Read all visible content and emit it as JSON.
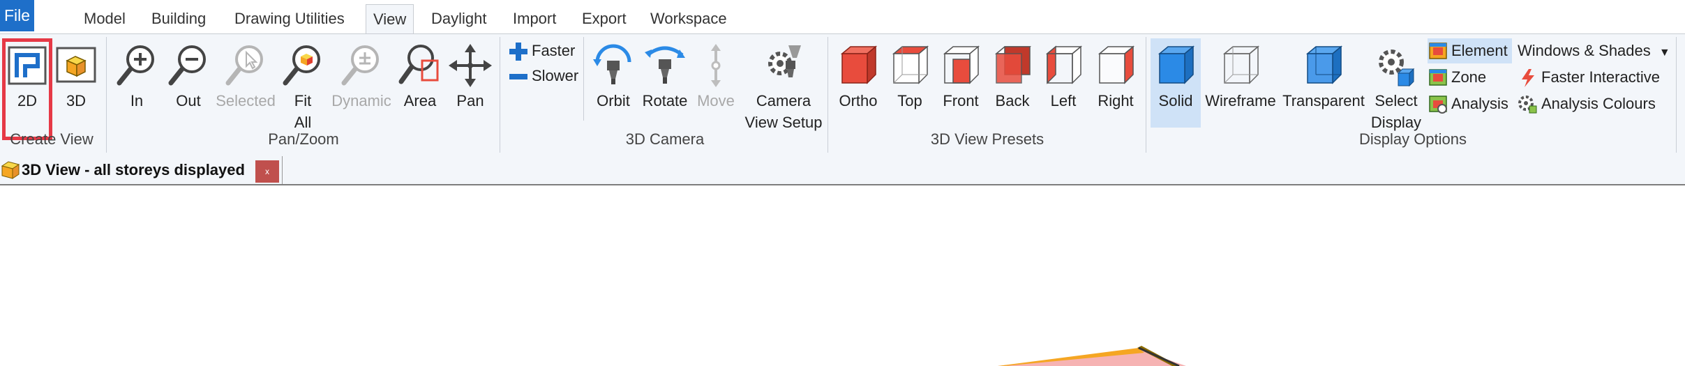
{
  "menubar": {
    "file": "File",
    "tabs": [
      "Model",
      "Building",
      "Drawing Utilities",
      "View",
      "Daylight",
      "Import",
      "Export",
      "Workspace"
    ],
    "active_tab": "View"
  },
  "ribbon": {
    "create_view": {
      "label": "Create View",
      "btn_2d": "2D",
      "btn_3d": "3D"
    },
    "pan_zoom": {
      "label": "Pan/Zoom",
      "in": "In",
      "out": "Out",
      "selected": "Selected",
      "fit_all": "Fit\nAll",
      "dynamic": "Dynamic",
      "area": "Area",
      "pan": "Pan"
    },
    "camera": {
      "label": "3D Camera",
      "faster": "Faster",
      "slower": "Slower",
      "orbit": "Orbit",
      "rotate": "Rotate",
      "move": "Move",
      "camera_view_setup": "Camera\nView Setup"
    },
    "presets": {
      "label": "3D View Presets",
      "ortho": "Ortho",
      "top": "Top",
      "front": "Front",
      "back": "Back",
      "left": "Left",
      "right": "Right"
    },
    "display": {
      "label": "Display Options",
      "solid": "Solid",
      "wireframe": "Wireframe",
      "transparent": "Transparent",
      "select_display": "Select\nDisplay",
      "element": "Element",
      "zone": "Zone",
      "analysis": "Analysis",
      "windows_shades": "Windows & Shades",
      "faster_interactive": "Faster Interactive",
      "analysis_colours": "Analysis Colours"
    }
  },
  "document": {
    "tab_title": "3D View - all storeys displayed",
    "close": "x"
  },
  "colors": {
    "accent": "#1e6fc9",
    "highlight": "#e63946",
    "preset_red": "#e84c3d",
    "solid_blue": "#2b8ae6",
    "model_orange": "#f5a623"
  }
}
